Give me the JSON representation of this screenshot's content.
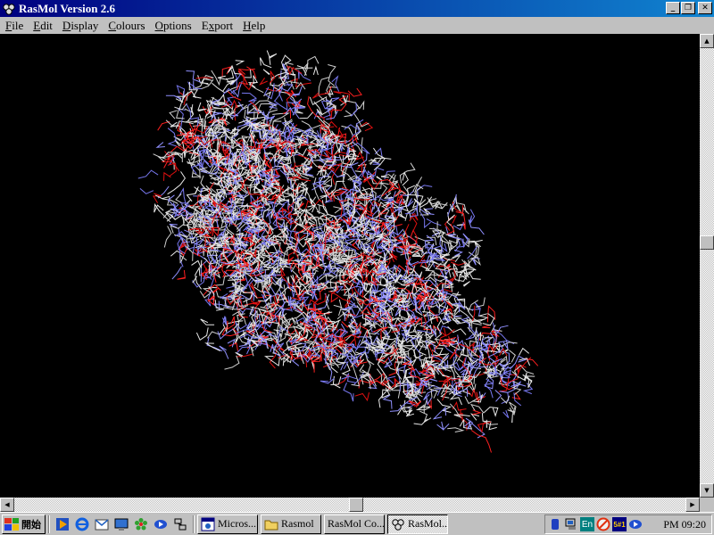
{
  "window": {
    "title": "RasMol Version 2.6",
    "controls": {
      "minimize": "_",
      "maximize": "❐",
      "close": "✕"
    }
  },
  "menu": [
    {
      "label": "File",
      "accel": "F",
      "rest": "ile"
    },
    {
      "label": "Edit",
      "accel": "E",
      "rest": "dit"
    },
    {
      "label": "Display",
      "accel": "D",
      "rest": "isplay"
    },
    {
      "label": "Colours",
      "accel": "C",
      "rest": "olours"
    },
    {
      "label": "Options",
      "accel": "O",
      "rest": "ptions"
    },
    {
      "label": "Export",
      "accel": "x",
      "rest_before": "E",
      "rest": "port"
    },
    {
      "label": "Help",
      "accel": "H",
      "rest": "elp"
    }
  ],
  "viewer": {
    "background": "#000000",
    "bond_colors": [
      "#e8e8e8",
      "#d0d0d0",
      "#9090ff",
      "#7878f0",
      "#ff2020",
      "#e01010"
    ],
    "molecule": "protein wireframe"
  },
  "taskbar": {
    "start_label": "開始",
    "quicklaunch": [
      "media-player-icon",
      "internet-explorer-icon",
      "outlook-express-icon",
      "show-desktop-icon",
      "icq-icon",
      "msn-icon",
      "network-icon"
    ],
    "tasks": [
      {
        "label": "Micros...",
        "icon": "app-window-icon",
        "active": false
      },
      {
        "label": "Rasmol",
        "icon": "folder-icon",
        "active": false
      },
      {
        "label": "RasMol Co...",
        "icon": "",
        "active": false
      },
      {
        "label": "RasMol...",
        "icon": "rasmol-icon",
        "active": true
      }
    ],
    "tray": [
      "speaker-icon",
      "network-tray-icon",
      "language-en-icon",
      "antivirus-icon",
      "input-method-icon",
      "msn-tray-icon"
    ],
    "tray_en_label": "En",
    "tray_ime_label": "5#1",
    "clock": "PM 09:20"
  }
}
